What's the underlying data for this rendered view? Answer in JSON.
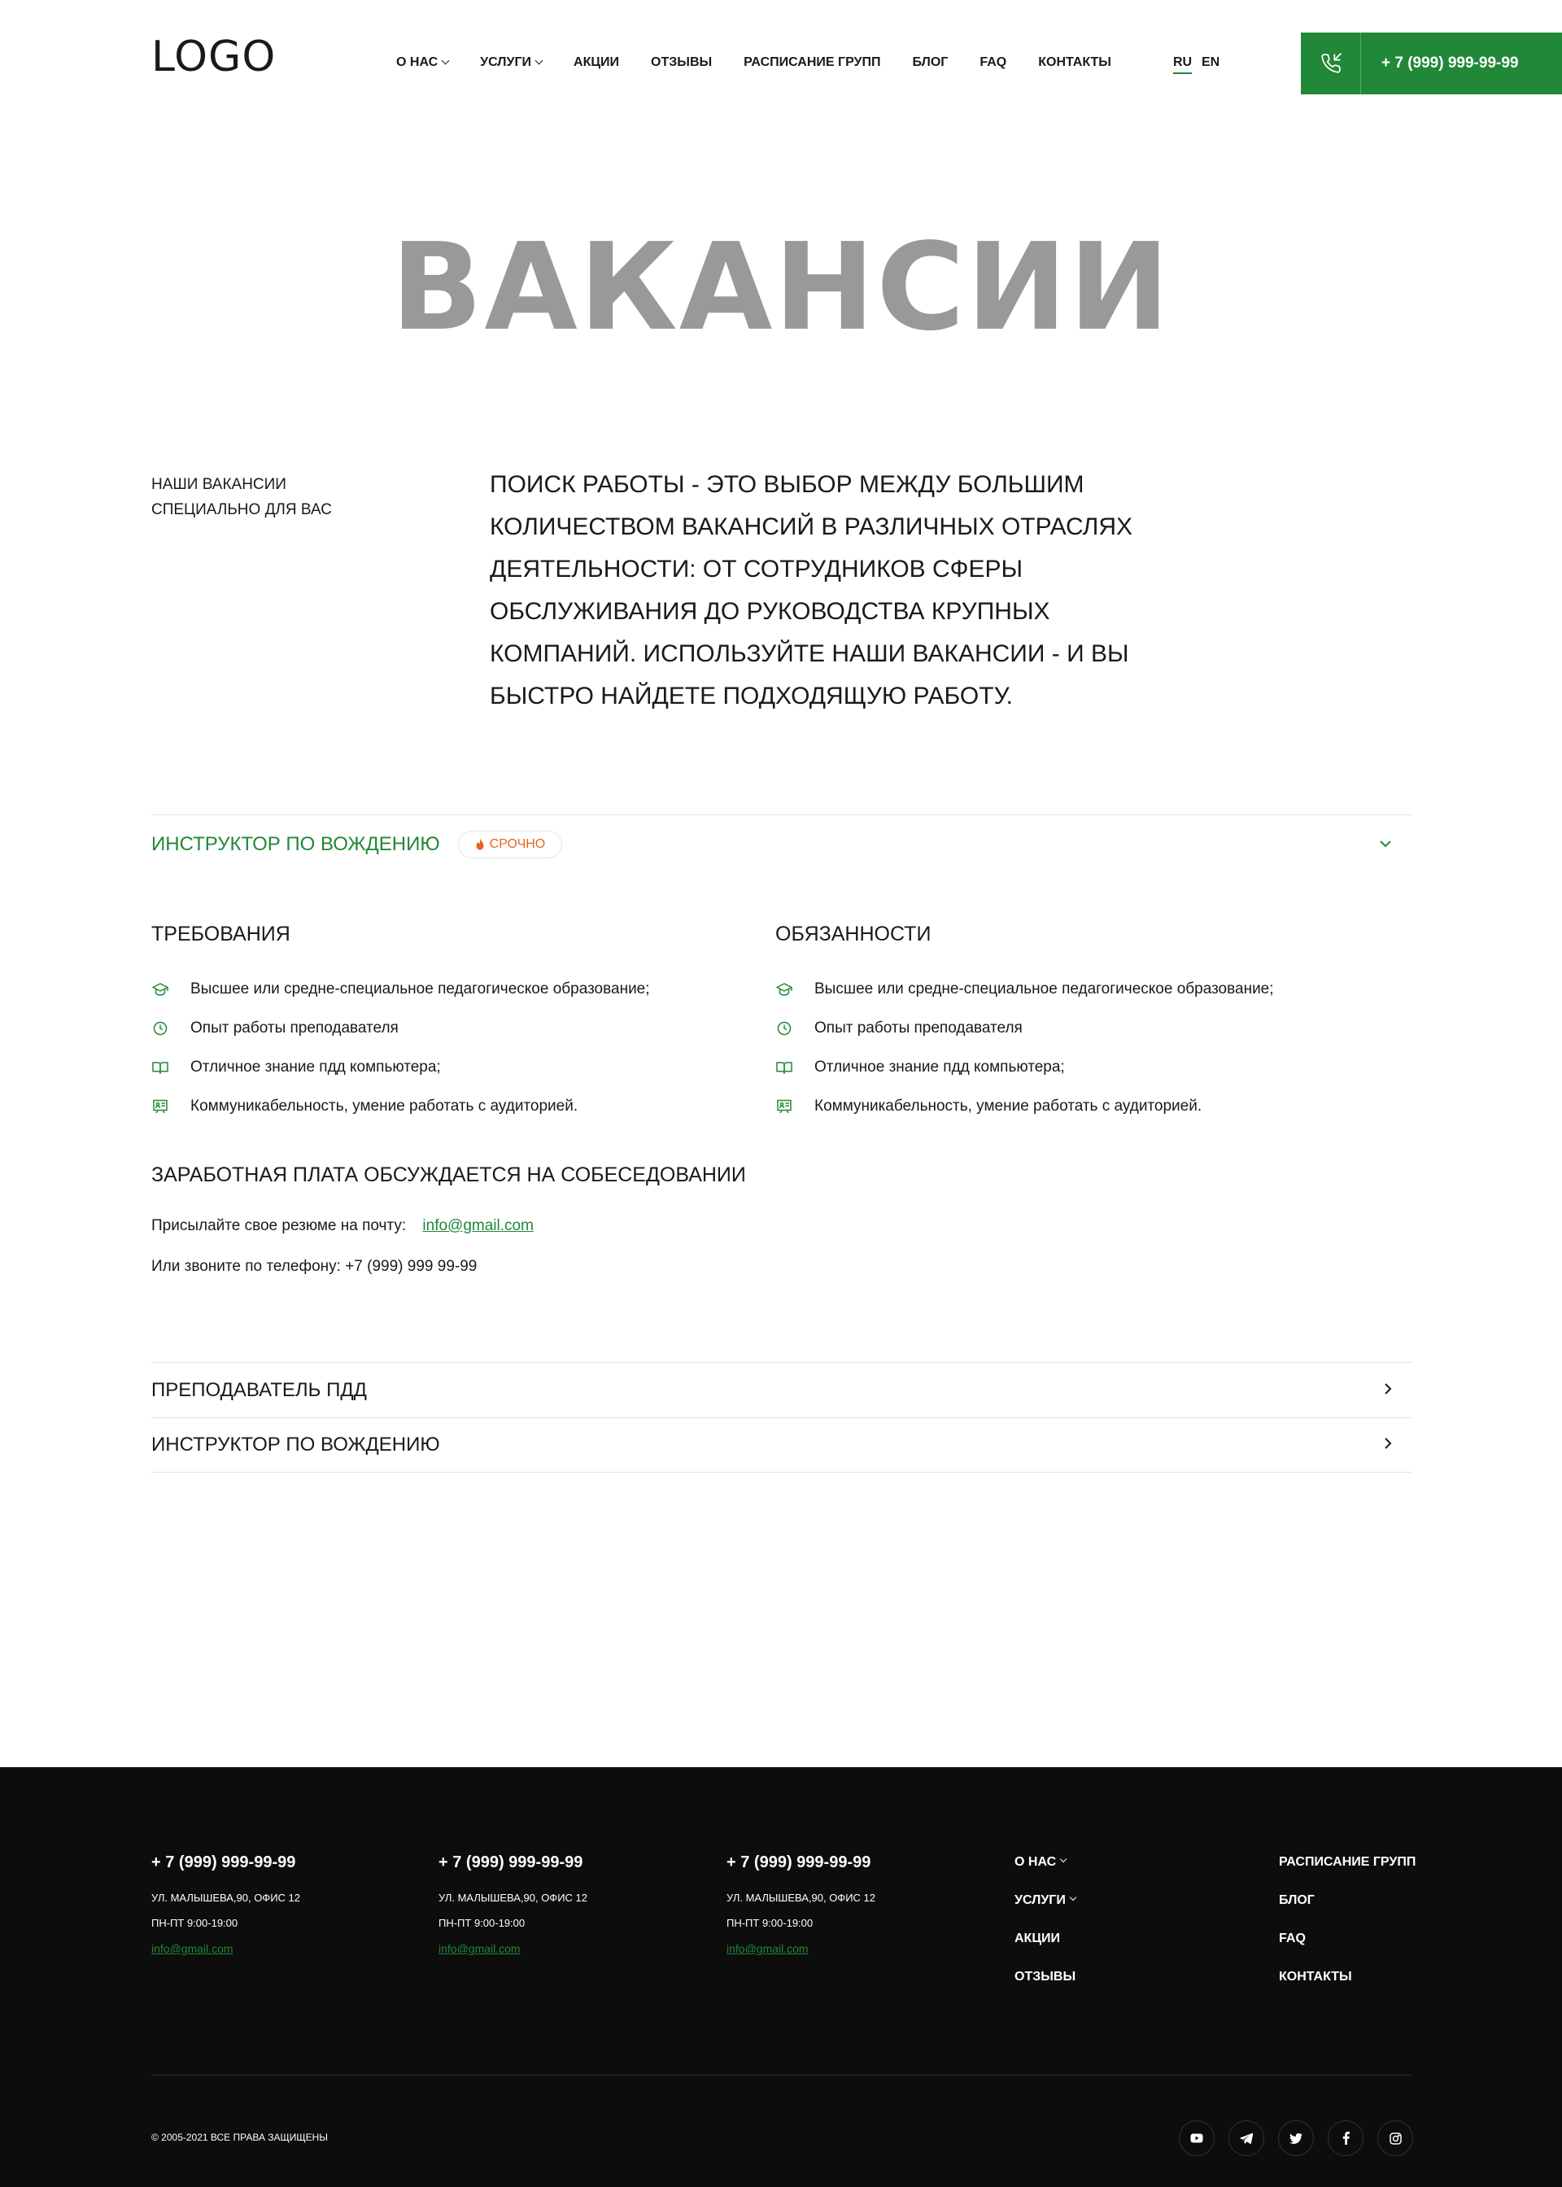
{
  "header": {
    "logo": "LOGO",
    "nav": [
      {
        "label": "О НАС"
      },
      {
        "label": "УСЛУГИ"
      },
      {
        "label": "АКЦИИ"
      },
      {
        "label": "ОТЗЫВЫ"
      },
      {
        "label": "РАСПИСАНИЕ ГРУПП"
      },
      {
        "label": "БЛОГ"
      },
      {
        "label": "FAQ"
      },
      {
        "label": "КОНТАКТЫ"
      }
    ],
    "lang_active": "RU",
    "lang_other": "EN",
    "phone": "+ 7 (999) 999-99-99",
    "accent_color": "#218838"
  },
  "hero": {
    "title": "ВАКАНСИИ"
  },
  "intro": {
    "label_line1": "НАШИ ВАКАНСИИ",
    "label_line2": "СПЕЦИАЛЬНО ДЛЯ ВАС",
    "text": "ПОИСК РАБОТЫ - ЭТО ВЫБОР МЕЖДУ БОЛЬШИМ КОЛИЧЕСТВОМ ВАКАНСИЙ В РАЗЛИЧНЫХ ОТРАСЛЯХ ДЕЯТЕЛЬНОСТИ: ОТ СОТРУДНИКОВ СФЕРЫ ОБСЛУЖИВАНИЯ ДО РУКОВОДСТВА КРУПНЫХ КОМПАНИЙ. ИСПОЛЬЗУЙТЕ НАШИ ВАКАНСИИ - И ВЫ БЫСТРО НАЙДЕТЕ ПОДХОДЯЩУЮ РАБОТУ."
  },
  "vacancy_open": {
    "title": "ИНСТРУКТОР ПО ВОЖДЕНИЮ",
    "badge": "СРОЧНО",
    "requirements_title": "ТРЕБОВАНИЯ",
    "duties_title": "ОБЯЗАННОСТИ",
    "requirements": [
      {
        "icon": "graduation-cap-icon",
        "text": "Высшее или средне-специальное педагогическое образование;"
      },
      {
        "icon": "clock-icon",
        "text": "Опыт работы преподавателя"
      },
      {
        "icon": "book-icon",
        "text": "Отличное знание пдд компьютера;"
      },
      {
        "icon": "presentation-icon",
        "text": "Коммуникабельность, умение работать с аудиторией."
      }
    ],
    "duties": [
      {
        "icon": "graduation-cap-icon",
        "text": "Высшее или средне-специальное педагогическое образование;"
      },
      {
        "icon": "clock-icon",
        "text": "Опыт работы преподавателя"
      },
      {
        "icon": "book-icon",
        "text": "Отличное знание пдд компьютера;"
      },
      {
        "icon": "presentation-icon",
        "text": "Коммуникабельность, умение работать с аудиторией."
      }
    ],
    "salary": "ЗАРАБОТНАЯ ПЛАТА ОБСУЖДАЕТСЯ НА СОБЕСЕДОВАНИИ",
    "send_cv": "Присылайте свое резюме на почту:",
    "email": "info@gmail.com",
    "call": "Или звоните по телефону: +7 (999) 999 99-99"
  },
  "vacancies_collapsed": [
    {
      "title": "ПРЕПОДАВАТЕЛЬ ПДД"
    },
    {
      "title": "ИНСТРУКТОР ПО ВОЖДЕНИЮ"
    }
  ],
  "footer": {
    "contacts": [
      {
        "phone": "+ 7 (999) 999-99-99",
        "address": "УЛ. МАЛЫШЕВА,90, ОФИС 12",
        "hours": "ПН-ПТ 9:00-19:00",
        "email": "info@gmail.com"
      },
      {
        "phone": "+ 7 (999) 999-99-99",
        "address": "УЛ. МАЛЫШЕВА,90, ОФИС 12",
        "hours": "ПН-ПТ 9:00-19:00",
        "email": "info@gmail.com"
      },
      {
        "phone": "+ 7 (999) 999-99-99",
        "address": "УЛ. МАЛЫШЕВА,90, ОФИС 12",
        "hours": "ПН-ПТ 9:00-19:00",
        "email": "info@gmail.com"
      }
    ],
    "nav_col1": [
      "О НАС",
      "УСЛУГИ",
      "АКЦИИ",
      "ОТЗЫВЫ"
    ],
    "nav_col2": [
      "РАСПИСАНИЕ ГРУПП",
      "БЛОГ",
      "FAQ",
      "КОНТАКТЫ"
    ],
    "copyright": "© 2005-2021 ВСЕ ПРАВА ЗАЩИЩЕНЫ",
    "socials": [
      "youtube-icon",
      "telegram-icon",
      "twitter-icon",
      "facebook-icon",
      "instagram-icon"
    ],
    "background": "#0d0d0d"
  }
}
